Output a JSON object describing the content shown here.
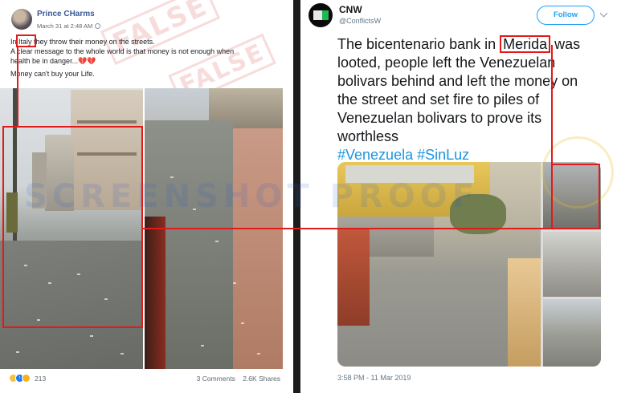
{
  "facebook": {
    "author": "Prince CHarms",
    "date": "March 31 at 2:48 AM",
    "text": {
      "line1_pre": "In ",
      "line1_highlight": "Italy",
      "line1_post": " they throw their money on the streets.",
      "line2": "A clear message to the whole world is that money is not enough when health be in danger...",
      "line2_emoji": "💔💔",
      "line3": "Money can't buy your Life."
    },
    "reaction_count": "213",
    "comments": "3 Comments",
    "shares": "2.6K Shares",
    "stamp": "FALSE"
  },
  "twitter": {
    "name": "CNW",
    "handle": "@ConflictsW",
    "follow_label": "Follow",
    "text": {
      "l1_pre": "The bicentenario bank in ",
      "l1_highlight": "Merida",
      "l1_post": " was",
      "l2": "looted, people left the Venezuelan",
      "l3": "bolivars behind and left the money on",
      "l4": "the street and set fire to piles of",
      "l5": "Venezuelan bolivars to prove its",
      "l6": "worthless"
    },
    "hashtags": "#Venezuela #SinLuz",
    "timestamp": "3:58 PM - 11 Mar 2019"
  },
  "watermark": "SCREENSHOT PROOF",
  "colors": {
    "highlight_red": "#e01b1b",
    "facebook_blue": "#385898",
    "twitter_blue": "#1da1f2"
  },
  "icons": [
    "globe-icon",
    "sad-reaction-icon",
    "like-reaction-icon",
    "wow-reaction-icon",
    "chevron-down-icon"
  ]
}
